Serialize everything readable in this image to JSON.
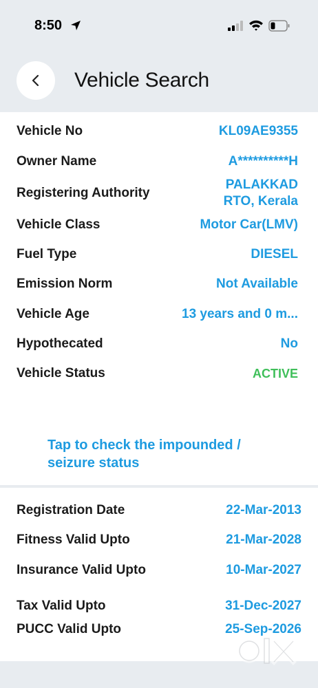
{
  "status_bar": {
    "time": "8:50",
    "icons": [
      "location-arrow-icon",
      "cellular-signal-icon",
      "wifi-icon",
      "battery-icon"
    ]
  },
  "header": {
    "back_icon": "chevron-left-icon",
    "title": "Vehicle Search"
  },
  "vehicle_details": [
    {
      "label": "Vehicle No",
      "value": "KL09AE9355"
    },
    {
      "label": "Owner Name",
      "value": "A**********H"
    },
    {
      "label": "Registering Authority",
      "value_line1": "PALAKKAD",
      "value_line2": "RTO, Kerala"
    },
    {
      "label": "Vehicle Class",
      "value": "Motor Car(LMV)"
    },
    {
      "label": "Fuel Type",
      "value": "DIESEL"
    },
    {
      "label": "Emission Norm",
      "value": "Not Available"
    },
    {
      "label": "Vehicle Age",
      "value": "13 years and 0 m..."
    },
    {
      "label": "Hypothecated",
      "value": "No"
    },
    {
      "label": "Vehicle Status",
      "value": "ACTIVE"
    }
  ],
  "impound_link": {
    "line1": "Tap to check the impounded /",
    "line2": "seizure status"
  },
  "validity_dates": [
    {
      "label": "Registration Date",
      "value": "22-Mar-2013"
    },
    {
      "label": "Fitness Valid Upto",
      "value": "21-Mar-2028"
    },
    {
      "label": "Insurance Valid Upto",
      "value": "10-Mar-2027"
    },
    {
      "label": "Tax Valid Upto",
      "value": "31-Dec-2027"
    },
    {
      "label": "PUCC Valid Upto",
      "value": "25-Sep-2026"
    }
  ],
  "watermark": {
    "logo_text": "OLX"
  },
  "colors": {
    "accent_blue": "#1e9be0",
    "status_active": "#3fbf5a",
    "background": "#e8ecf0",
    "card": "#ffffff"
  }
}
